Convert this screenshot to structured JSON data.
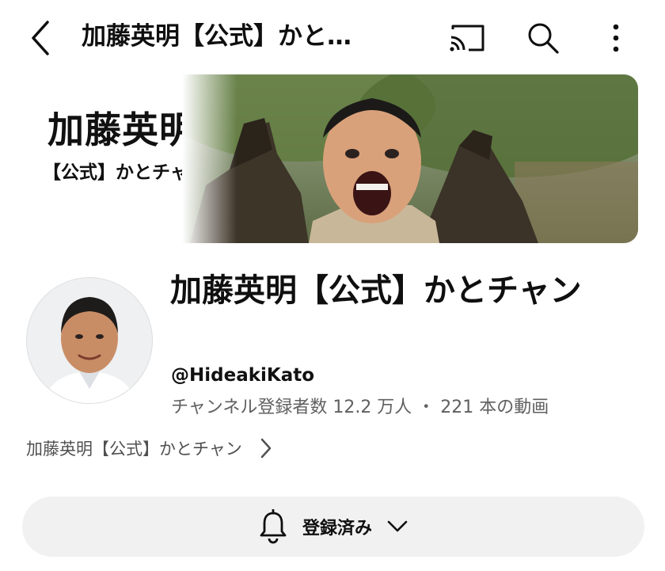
{
  "header": {
    "title": "加藤英明【公式】かと…",
    "icons": [
      "back-icon",
      "cast-icon",
      "search-icon",
      "more-icon"
    ]
  },
  "banner": {
    "title": "加藤英明",
    "subtitle": "【公式】かとチャン"
  },
  "channel": {
    "name": "加藤英明【公式】かとチャン",
    "handle": "@HideakiKato",
    "stats": "チャンネル登録者数 12.2 万人 ・ 221 本の動画",
    "about_link": "加藤英明【公式】かとチャン"
  },
  "subscribe": {
    "label": "登録済み",
    "icons": [
      "bell-icon",
      "chevron-down-icon"
    ]
  }
}
